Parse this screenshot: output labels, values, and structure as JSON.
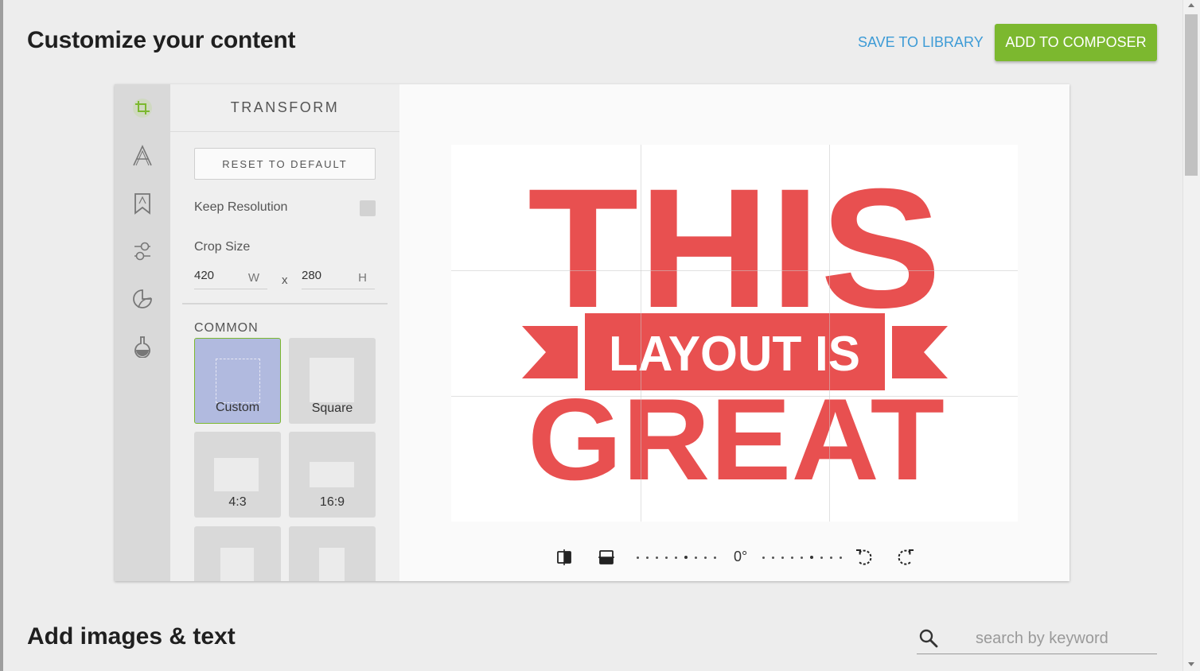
{
  "header": {
    "title": "Customize your content",
    "save_label": "SAVE TO LIBRARY",
    "add_label": "ADD TO COMPOSER"
  },
  "toolbar": {
    "tools": [
      {
        "icon": "crop-icon",
        "active": true
      },
      {
        "icon": "text-icon"
      },
      {
        "icon": "bookmark-icon"
      },
      {
        "icon": "adjust-icon"
      },
      {
        "icon": "sticker-icon"
      },
      {
        "icon": "flask-icon"
      }
    ]
  },
  "panel": {
    "title": "TRANSFORM",
    "reset_label": "RESET TO DEFAULT",
    "keep_resolution_label": "Keep Resolution",
    "crop_size_label": "Crop Size",
    "width_value": "420",
    "width_unit": "W",
    "separator": "x",
    "height_value": "280",
    "height_unit": "H",
    "common_label": "COMMON",
    "presets": [
      {
        "label": "Custom",
        "selected": true
      },
      {
        "label": "Square"
      },
      {
        "label": "4:3"
      },
      {
        "label": "16:9"
      },
      {
        "label": ""
      },
      {
        "label": ""
      }
    ]
  },
  "canvas": {
    "image_text": {
      "line1": "THIS",
      "line2": "LAYOUT IS",
      "line3": "GREAT"
    },
    "rotation_label": "0°"
  },
  "section": {
    "title": "Add images & text",
    "search_placeholder": "search by keyword"
  },
  "colors": {
    "accent_green": "#7cb82f",
    "link_blue": "#3d9bd6",
    "logo_red": "#e85050",
    "selected_preset": "#b1badf"
  }
}
